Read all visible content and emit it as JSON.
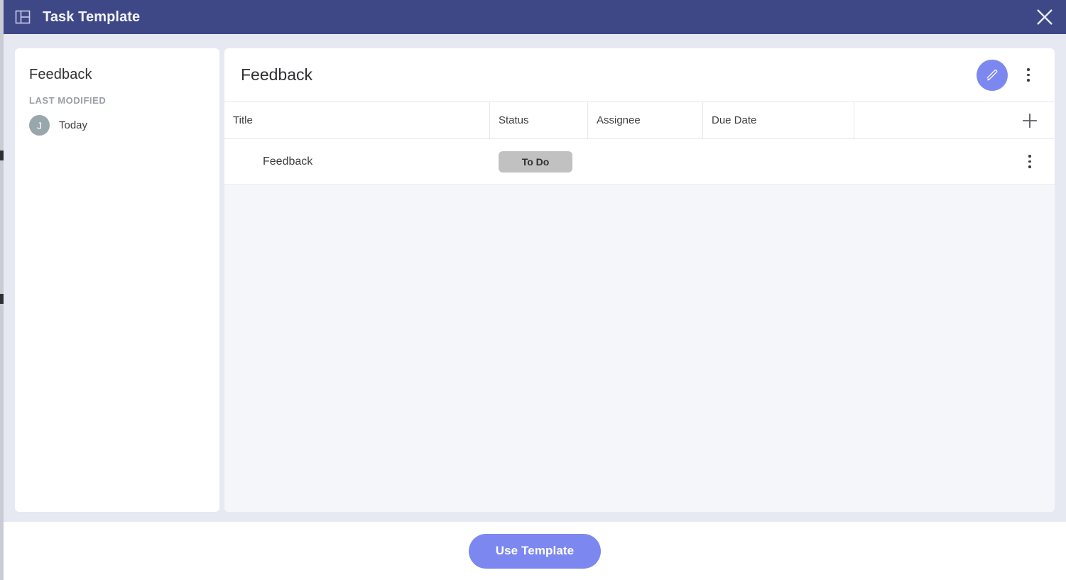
{
  "window": {
    "title": "Task Template",
    "icon": "layout-template-icon",
    "close_icon": "close-icon",
    "header_bg": "#3f4887"
  },
  "sidebar": {
    "title": "Feedback",
    "section_label": "LAST MODIFIED",
    "avatar_initial": "J",
    "avatar_color": "#98a7ac",
    "modified_text": "Today"
  },
  "main": {
    "title": "Feedback",
    "edit_button": {
      "icon": "pencil-icon",
      "color": "#7c88ef"
    },
    "more_menu_icon": "kebab-menu-icon",
    "add_column_icon": "plus-icon",
    "table": {
      "columns": [
        "Title",
        "Status",
        "Assignee",
        "Due Date"
      ],
      "rows": [
        {
          "title": "Feedback",
          "status": "To Do",
          "status_color": "#c1c1c1",
          "assignee": "",
          "due_date": "",
          "row_menu_icon": "kebab-menu-icon"
        }
      ]
    }
  },
  "footer": {
    "use_template_label": "Use Template",
    "use_template_color": "#7c88ef"
  }
}
